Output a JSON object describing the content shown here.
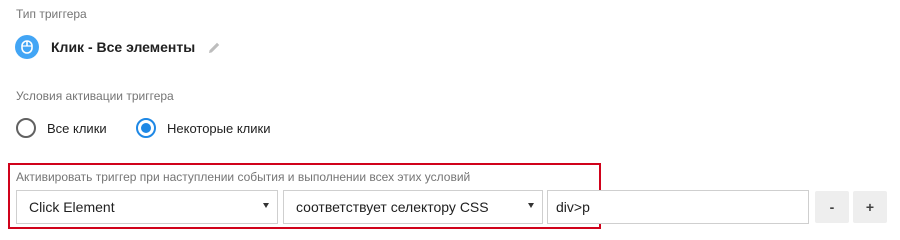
{
  "trigger_type": {
    "label": "Тип триггера",
    "name": "Клик - Все элементы",
    "icon": "mouse-icon",
    "icon_color": "#42a5f5"
  },
  "activation": {
    "label": "Условия активации триггера",
    "options": [
      {
        "label": "Все клики",
        "selected": false
      },
      {
        "label": "Некоторые клики",
        "selected": true
      }
    ],
    "accent_color": "#1e88e5"
  },
  "conditions": {
    "caption": "Активировать триггер при наступлении события и выполнении всех этих условий",
    "highlight_color": "#d0021b",
    "variable": "Click Element",
    "operator": "соответствует селектору CSS",
    "value": "div>p",
    "remove_label": "-",
    "add_label": "+"
  }
}
